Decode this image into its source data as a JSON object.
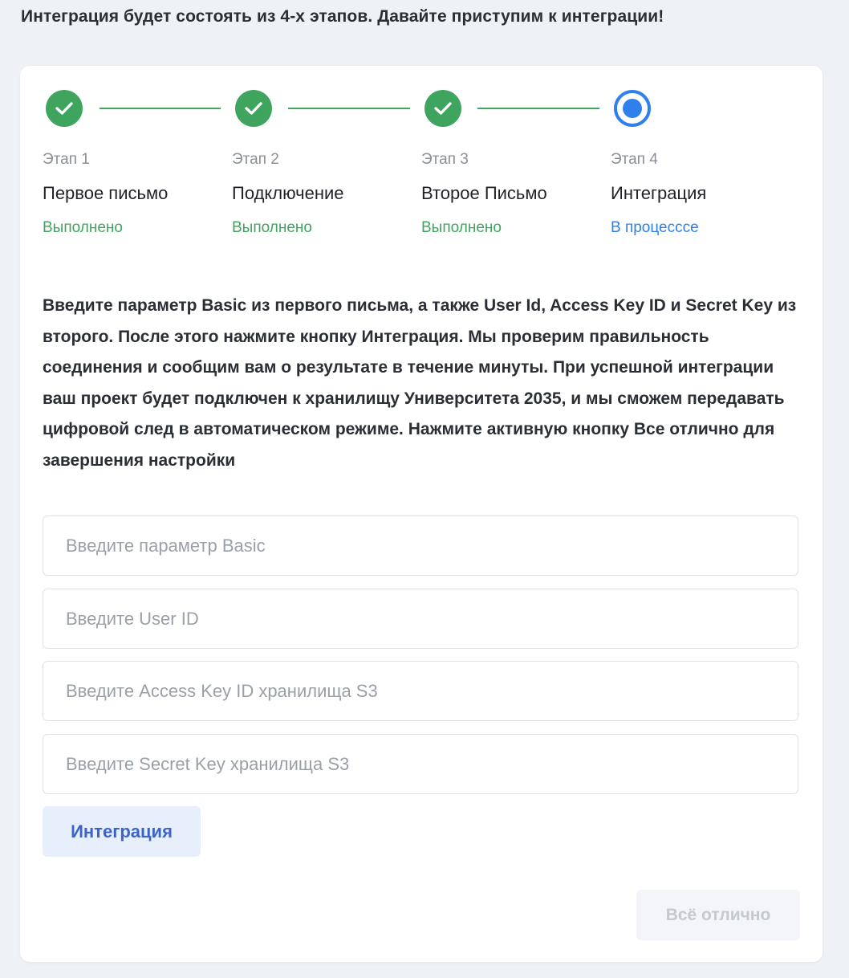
{
  "intro_text": "Интеграция будет состоять из 4-х этапов. Давайте приступим к интеграции!",
  "colors": {
    "done": "#3fa55e",
    "active": "#2f80ed",
    "integrate_button_bg": "#e8effc",
    "integrate_button_text": "#3d63c9"
  },
  "steps": [
    {
      "label": "Этап 1",
      "name": "Первое письмо",
      "status": "Выполнено",
      "state": "done",
      "icon": "check-icon"
    },
    {
      "label": "Этап 2",
      "name": "Подключение",
      "status": "Выполнено",
      "state": "done",
      "icon": "check-icon"
    },
    {
      "label": "Этап 3",
      "name": "Второе Письмо",
      "status": "Выполнено",
      "state": "done",
      "icon": "check-icon"
    },
    {
      "label": "Этап 4",
      "name": "Интеграция",
      "status": "В процесссе",
      "state": "active",
      "icon": "radio-active-icon"
    }
  ],
  "description": "Введите параметр Basic из первого письма, а также User Id, Access Key ID и Secret Key из второго. После этого нажмите кнопку Интеграция. Мы проверим правильность соединения и сообщим вам о результате в течение минуты. При успешной интеграции ваш проект будет подключен к хранилищу Университета 2035, и мы сможем передавать цифровой след в автоматическом режиме. Нажмите активную кнопку Все отлично для завершения настройки",
  "form": {
    "basic": {
      "placeholder": "Введите параметр Basic",
      "value": ""
    },
    "user_id": {
      "placeholder": "Введите User ID",
      "value": ""
    },
    "access_key": {
      "placeholder": "Введите Access Key ID хранилища S3",
      "value": ""
    },
    "secret_key": {
      "placeholder": "Введите Secret Key хранилища S3",
      "value": ""
    }
  },
  "buttons": {
    "integrate": "Интеграция",
    "done": "Всё отлично"
  }
}
